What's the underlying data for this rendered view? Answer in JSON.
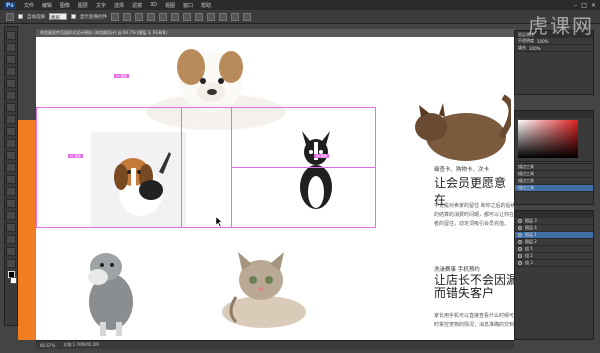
{
  "app": {
    "logo": "Ps",
    "menu": [
      "文件",
      "编辑",
      "图像",
      "图层",
      "文字",
      "选择",
      "滤镜",
      "3D",
      "视图",
      "窗口",
      "帮助"
    ]
  },
  "options": {
    "auto_select_label": "自动选择",
    "layer_select": "图层",
    "show_transform_label": "显示变换控件"
  },
  "document": {
    "tab_title": "浏览器宣传页面样式设计网站 (浏览器设计) @ 66.7% (图层 3, RGB/8)"
  },
  "canvas": {
    "slice_tags": [
      "01 图层",
      "02 图层",
      "03 图层"
    ],
    "section1_small": "细查卡、购物卡、次卡",
    "section1_heading": "让会员更愿意在",
    "section1_body": "不论是对卖家的留住 和你之后的后续 让会员的结算的消费时间期，都可以让你在保持营销者的留住，动定词吸引会员充值。",
    "section2_small": "洗澡赛事 手机预约",
    "section2_heading": "让店长不会因漏\n而错失客户",
    "section2_body": "家长用手机可以直接查看什么时候可以做，随时掌控宠物的情况，消息准确的交到第一手。"
  },
  "status": {
    "zoom": "66.67%",
    "doc_info": "文档:1.76M/40.2M"
  },
  "panels": {
    "properties_title": "图层属性",
    "opacity_label": "不透明度",
    "opacity_value": "100%",
    "fill_label": "填充",
    "fill_value": "100%",
    "layers": [
      "描边工具",
      "描边工具",
      "描边工具",
      "描边工具"
    ],
    "layers2": [
      "图层 3",
      "图层 4",
      "图层 1",
      "图层 2",
      "组 1",
      "组 2",
      "组 3"
    ]
  },
  "watermark": "虎课网"
}
